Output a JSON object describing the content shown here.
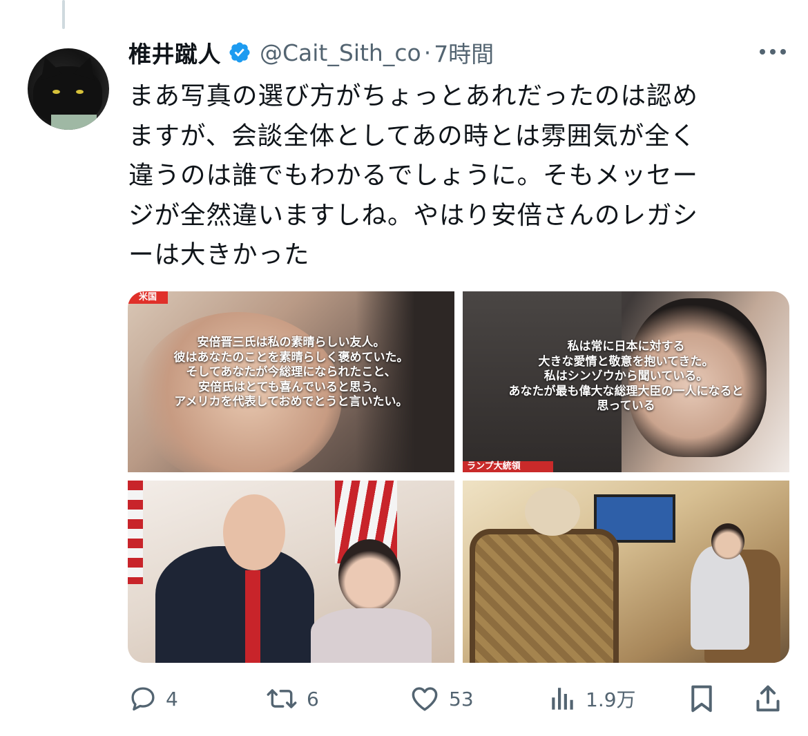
{
  "tweet": {
    "author_name": "椎井蹴人",
    "handle": "@Cait_Sith_co",
    "separator": "·",
    "time": "7時間",
    "text": "まあ写真の選び方がちょっとあれだったのは認めますが、会談全体としてあの時とは雰囲気が全く違うのは誰でもわかるでしょうに。そもメッセージが全然違いますしね。やはり安倍さんのレガシーは大きかった",
    "text_lines": [
      "まあ写真の選び方がちょっとあれだったのは認め",
      "ますが、会談全体としてあの時とは雰囲気が全く",
      "違うのは誰でもわかるでしょうに。そもメッセー",
      "ジが全然違いますしね。やはり安倍さんのレガシ",
      "ーは大きかった"
    ]
  },
  "media": {
    "photo1": {
      "badge": "米国",
      "overlay_lines": [
        "安倍晋三氏は私の素晴らしい友人。",
        "彼はあなたのことを素晴らしく褒めていた。",
        "そしてあなたが今総理になられたこと、",
        "安倍氏はとても喜んでいると思う。",
        "アメリカを代表しておめでとうと言いたい。"
      ]
    },
    "photo2": {
      "overlay_lines": [
        "私は常に日本に対する",
        "大きな愛情と敬意を抱いてきた。",
        "私はシンゾウから聞いている。",
        "あなたが最も偉大な総理大臣の一人になると",
        "思っている"
      ],
      "caption": "ランプ大統領"
    }
  },
  "actions": {
    "reply_count": "4",
    "retweet_count": "6",
    "like_count": "53",
    "views_count": "1.9万"
  },
  "icons": {
    "verified": "verified-badge-icon",
    "more": "more-icon",
    "reply": "reply-icon",
    "retweet": "retweet-icon",
    "like": "heart-icon",
    "views": "views-icon",
    "bookmark": "bookmark-icon",
    "share": "share-icon"
  },
  "colors": {
    "text": "#0f1419",
    "secondary": "#536471",
    "verified": "#1d9bf0"
  }
}
